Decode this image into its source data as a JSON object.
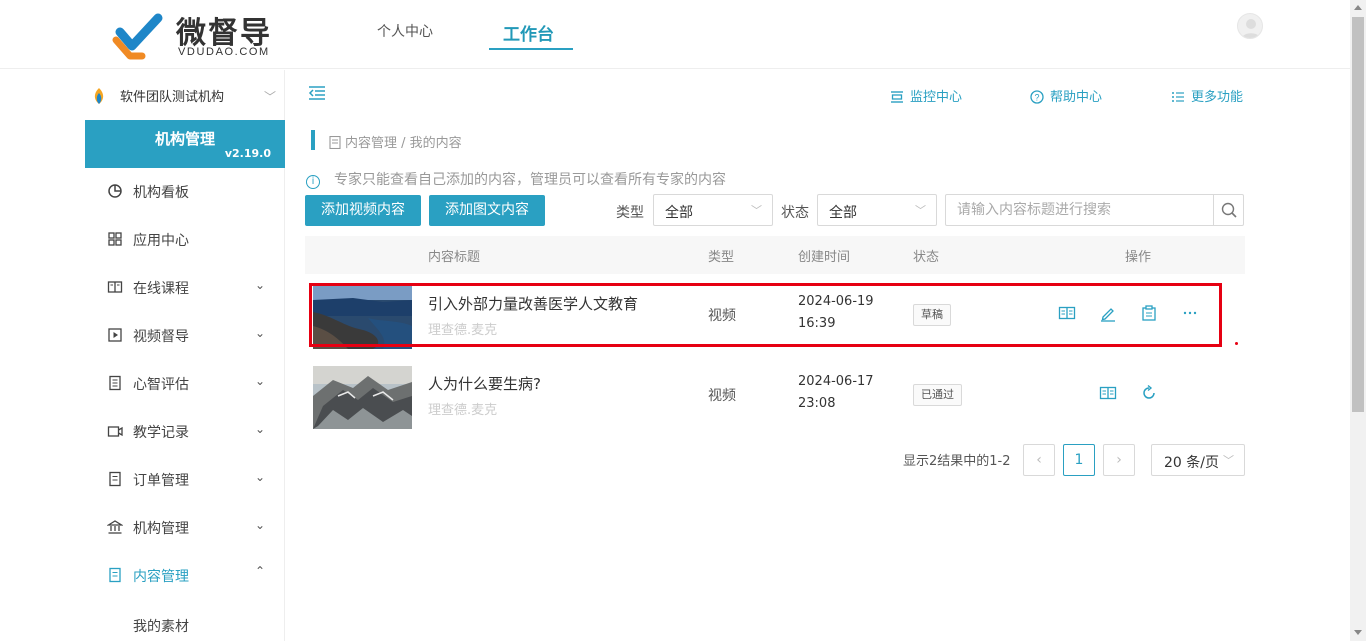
{
  "header": {
    "logo_text": "微督导",
    "logo_sub": "VDUDAO.COM",
    "nav": [
      {
        "label": "个人中心"
      },
      {
        "label": "工作台"
      }
    ]
  },
  "sidebar": {
    "org_name": "软件团队测试机构",
    "panel_title": "机构管理",
    "version": "v2.19.0",
    "items": [
      {
        "label": "机构看板",
        "icon": "dashboard-icon"
      },
      {
        "label": "应用中心",
        "icon": "grid-icon"
      },
      {
        "label": "在线课程",
        "icon": "book-icon"
      },
      {
        "label": "视频督导",
        "icon": "video-icon"
      },
      {
        "label": "心智评估",
        "icon": "assessment-icon"
      },
      {
        "label": "教学记录",
        "icon": "camera-icon"
      },
      {
        "label": "订单管理",
        "icon": "order-icon"
      },
      {
        "label": "机构管理",
        "icon": "institution-icon"
      },
      {
        "label": "内容管理",
        "icon": "content-icon"
      }
    ],
    "submenu": [
      {
        "label": "我的素材"
      }
    ]
  },
  "toolbar": {
    "monitor": "监控中心",
    "help": "帮助中心",
    "more": "更多功能"
  },
  "breadcrumb": "内容管理 / 我的内容",
  "info_text": "专家只能查看自己添加的内容，管理员可以查看所有专家的内容",
  "actions": {
    "add_video": "添加视频内容",
    "add_article": "添加图文内容"
  },
  "filters": {
    "type_label": "类型",
    "type_value": "全部",
    "status_label": "状态",
    "status_value": "全部",
    "search_placeholder": "请输入内容标题进行搜索"
  },
  "table": {
    "columns": [
      "内容标题",
      "类型",
      "创建时间",
      "状态",
      "操作"
    ],
    "rows": [
      {
        "title": "引入外部力量改善医学人文教育",
        "author": "理查德.麦克",
        "type": "视频",
        "date": "2024-06-19",
        "time": "16:39",
        "status": "草稿"
      },
      {
        "title": "人为什么要生病?",
        "author": "理查德.麦克",
        "type": "视频",
        "date": "2024-06-17",
        "time": "23:08",
        "status": "已通过"
      }
    ]
  },
  "pagination": {
    "summary": "显示2结果中的1-2",
    "prev": "‹",
    "next": "›",
    "current": "1",
    "page_size": "20 条/页"
  },
  "colors": {
    "accent": "#2aa0c2",
    "highlight": "#e60012"
  }
}
